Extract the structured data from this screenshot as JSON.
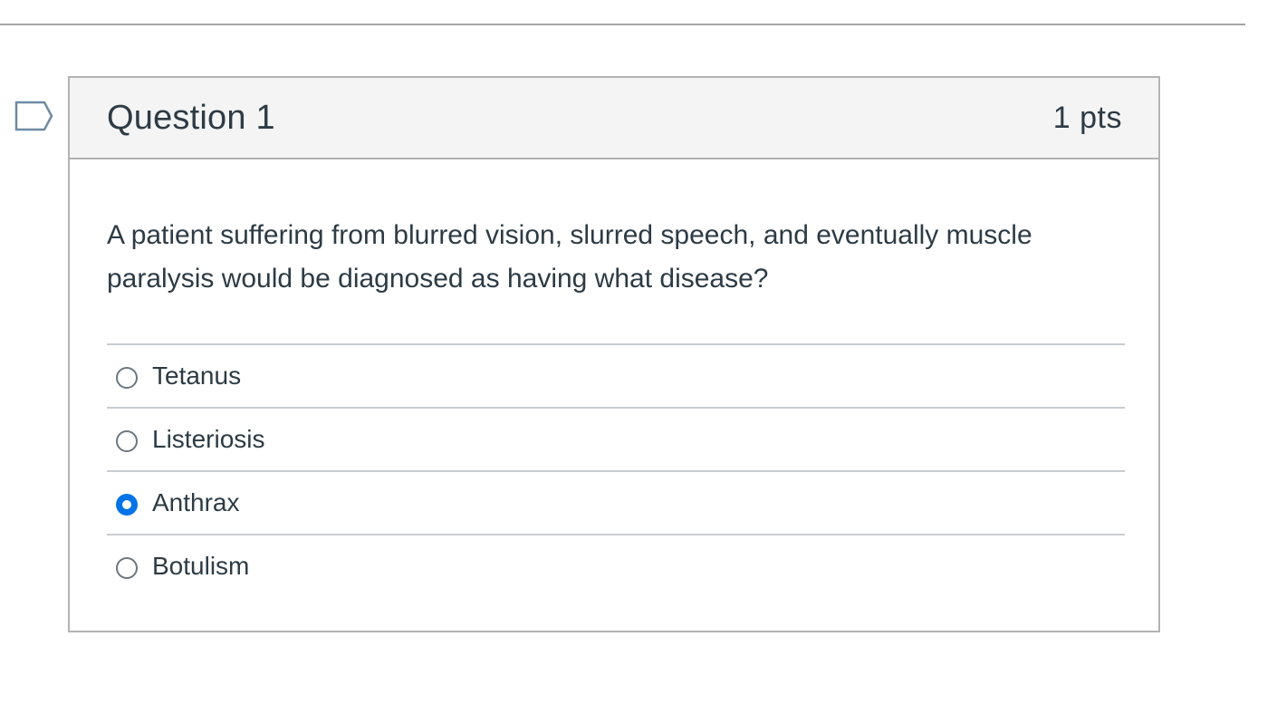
{
  "question": {
    "title": "Question 1",
    "points": "1 pts",
    "text": "A patient suffering from blurred vision, slurred speech, and eventually muscle paralysis would be diagnosed as having what disease?",
    "flag_icon": "bookmark-flag-icon"
  },
  "answers": [
    {
      "label": "Tetanus",
      "selected": false
    },
    {
      "label": "Listeriosis",
      "selected": false
    },
    {
      "label": "Anthrax",
      "selected": true
    },
    {
      "label": "Botulism",
      "selected": false
    }
  ],
  "colors": {
    "accent": "#0374e8",
    "text": "#2d3b45",
    "header_bg": "#f4f4f4",
    "border": "#b3b3b3",
    "flag": "#6e8aa3"
  }
}
